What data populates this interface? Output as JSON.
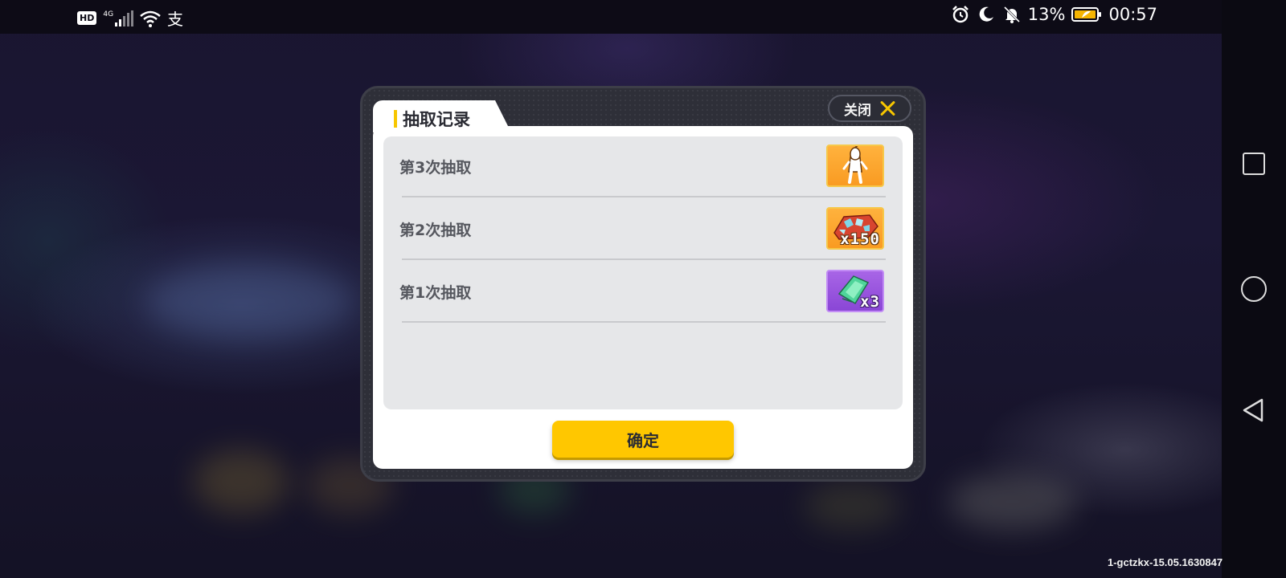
{
  "statusbar": {
    "left_icons": [
      "hd-icon",
      "4g-signal-icon",
      "wifi-icon",
      "alipay-icon"
    ],
    "hd_label": "HD",
    "network_label": "4G",
    "alipay_label": "支",
    "right_icons": [
      "alarm-icon",
      "moon-icon",
      "mute-bell-icon",
      "battery-icon"
    ],
    "battery_percent": "13%",
    "time": "00:57"
  },
  "dialog": {
    "title": "抽取记录",
    "close_label": "关闭",
    "confirm_label": "确定",
    "records": [
      {
        "label": "第3次抽取",
        "reward_icon": "character-figure-icon",
        "reward_color": "#f99b22",
        "quantity": ""
      },
      {
        "label": "第2次抽取",
        "reward_icon": "gem-pile-icon",
        "reward_color": "#f99b22",
        "quantity": "x150"
      },
      {
        "label": "第1次抽取",
        "reward_icon": "green-ticket-icon",
        "reward_color": "#8a46d6",
        "quantity": "x3"
      }
    ]
  },
  "navbar": {
    "buttons": [
      "recent-apps-square-icon",
      "home-circle-icon",
      "back-triangle-icon"
    ]
  },
  "footer": {
    "version": "1-gctzkx-15.05.1630847"
  },
  "colors": {
    "accent": "#ffc700",
    "dialog_frame": "#2e2f38",
    "list_bg": "#e6e7e9"
  }
}
